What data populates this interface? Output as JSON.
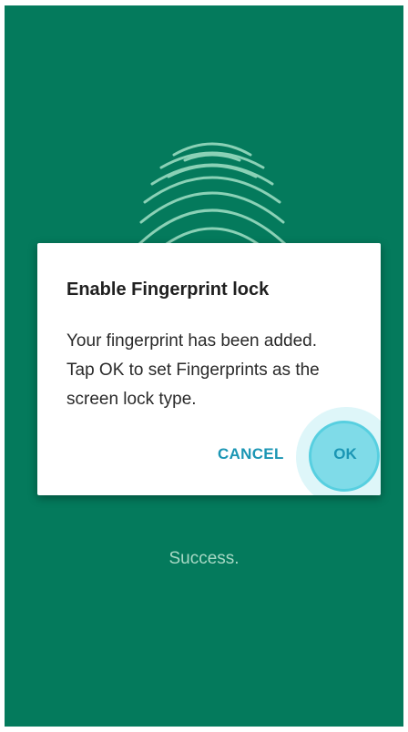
{
  "dialog": {
    "title": "Enable Fingerprint lock",
    "message_lines": [
      "Your fingerprint has been added.",
      "Tap OK to set Fingerprints as the",
      "screen lock type."
    ],
    "cancel_label": "CANCEL",
    "ok_label": "OK"
  },
  "status": {
    "text": "Success."
  },
  "icons": {
    "fingerprint": "fingerprint-icon"
  },
  "colors": {
    "background": "#047a5c",
    "accent": "#1b96b4",
    "ripple": "#7fdbe8",
    "status_text": "#a8d9c5"
  }
}
